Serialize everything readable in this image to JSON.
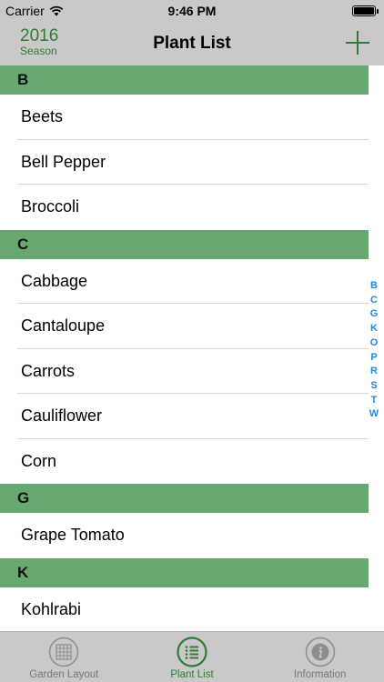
{
  "status_bar": {
    "carrier": "Carrier",
    "time": "9:46 PM",
    "wifi_icon": "wifi-icon",
    "battery_icon": "battery-icon"
  },
  "nav": {
    "season_year": "2016",
    "season_label": "Season",
    "title": "Plant List",
    "add_icon": "plus-icon"
  },
  "sections": [
    {
      "letter": "B",
      "items": [
        "Beets",
        "Bell Pepper",
        "Broccoli"
      ]
    },
    {
      "letter": "C",
      "items": [
        "Cabbage",
        "Cantaloupe",
        "Carrots",
        "Cauliflower",
        "Corn"
      ]
    },
    {
      "letter": "G",
      "items": [
        "Grape Tomato"
      ]
    },
    {
      "letter": "K",
      "items": [
        "Kohlrabi"
      ]
    }
  ],
  "index_letters": [
    "B",
    "C",
    "G",
    "K",
    "O",
    "P",
    "R",
    "S",
    "T",
    "W"
  ],
  "tabs": [
    {
      "label": "Garden Layout",
      "icon": "grid-icon",
      "active": false
    },
    {
      "label": "Plant List",
      "icon": "list-icon",
      "active": true
    },
    {
      "label": "Information",
      "icon": "info-icon",
      "active": false
    }
  ],
  "colors": {
    "accent_green": "#2e7d32",
    "section_header": "#66a86e",
    "bar_gray": "#c9c9c9",
    "index_blue": "#1e88e5"
  }
}
